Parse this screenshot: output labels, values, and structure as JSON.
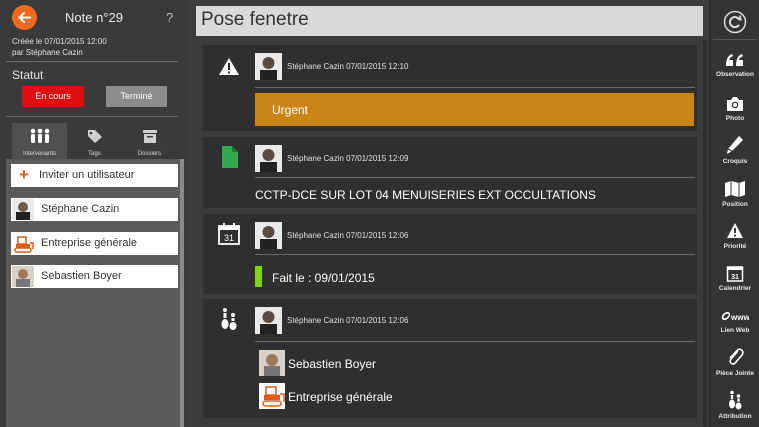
{
  "left": {
    "note_title": "Note n°29",
    "help": "?",
    "created_line1": "Créée le 07/01/2015 12:00",
    "created_line2": "par Stéphane Cazin",
    "statut_label": "Statut",
    "status_active": "En cours",
    "status_done": "Terminé",
    "tabs": [
      {
        "label": "Intervenants",
        "icon": "people-icon",
        "active": true
      },
      {
        "label": "Tags",
        "icon": "tag-icon",
        "active": false
      },
      {
        "label": "Dossiers",
        "icon": "folder-icon",
        "active": false
      }
    ],
    "invite_label": "Inviter un utilisateur",
    "participants": [
      {
        "name": "Stéphane Cazin",
        "avatar": "person-avatar"
      },
      {
        "name": "Entreprise générale",
        "avatar": "bulldozer-icon"
      },
      {
        "name": "Sebastien Boyer",
        "avatar": "person-avatar"
      }
    ]
  },
  "main": {
    "title": "Pose fenetre",
    "cards": [
      {
        "type": "priority",
        "icon": "warning-icon",
        "meta": "Stéphane Cazin 07/01/2015 12:10",
        "content": "Urgent"
      },
      {
        "type": "document",
        "icon": "document-icon",
        "meta": "Stéphane Cazin 07/01/2015 12:09",
        "content": "CCTP-DCE SUR LOT 04 MENUISERIES EXT OCCULTATIONS"
      },
      {
        "type": "calendar",
        "icon": "calendar-icon",
        "meta": "Stéphane Cazin 07/01/2015 12:06",
        "content": "Fait le :  09/01/2015"
      },
      {
        "type": "attribution",
        "icon": "attribution-icon",
        "meta": "Stéphane Cazin 07/01/2015 12:06",
        "people": [
          "Sebastien Boyer",
          "Entreprise générale"
        ]
      }
    ]
  },
  "right": {
    "buttons": [
      {
        "label": "Observation",
        "icon": "quote-icon"
      },
      {
        "label": "Photo",
        "icon": "camera-icon"
      },
      {
        "label": "Croquis",
        "icon": "pencil-icon"
      },
      {
        "label": "Position",
        "icon": "map-icon"
      },
      {
        "label": "Priorité",
        "icon": "warning-icon"
      },
      {
        "label": "Calendrier",
        "icon": "calendar-icon"
      },
      {
        "label": "Lien Web",
        "icon": "link-icon"
      },
      {
        "label": "Pièce Jointe",
        "icon": "paperclip-icon"
      },
      {
        "label": "Attribution",
        "icon": "attribution-icon"
      }
    ]
  },
  "colors": {
    "accent_orange": "#ee6a1e",
    "status_red": "#e00e0e",
    "urgent_orange": "#c98519",
    "done_green": "#7fd600",
    "document_green": "#2fa84f"
  }
}
